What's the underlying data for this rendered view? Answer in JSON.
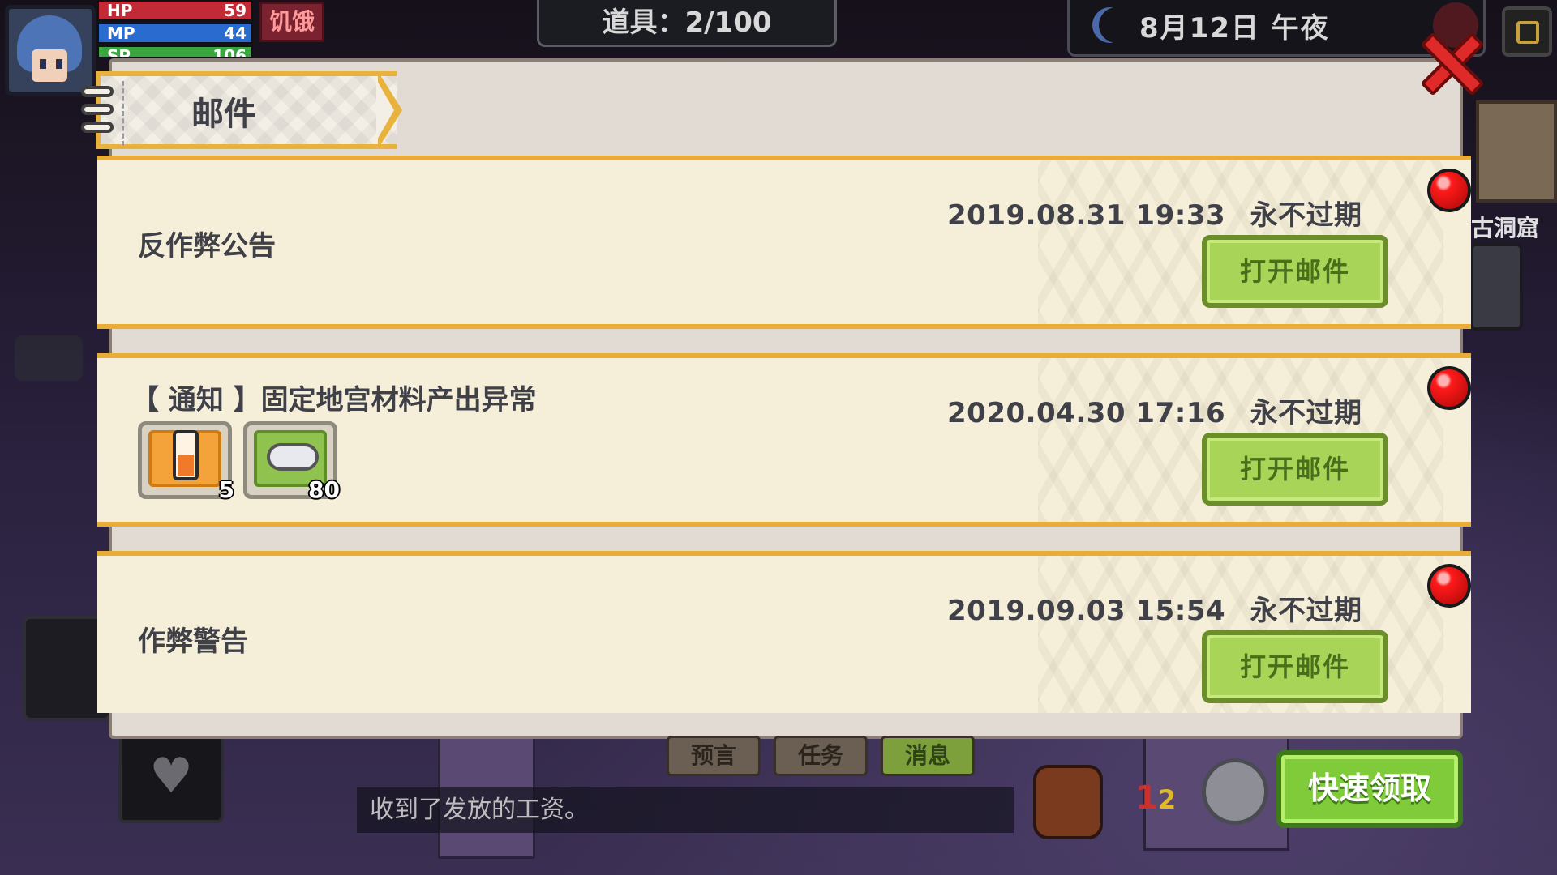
{
  "hud": {
    "hp_label": "HP",
    "hp_value": "59",
    "mp_label": "MP",
    "mp_value": "44",
    "sp_label": "SP",
    "sp_value": "106",
    "hunger_label": "饥饿",
    "items_count": "道具：2/100",
    "date": "8月12日  午夜"
  },
  "world": {
    "cave_label": "古洞窟"
  },
  "mail_panel": {
    "title": "邮件",
    "mails": [
      {
        "title": "反作弊公告",
        "date": "2019.08.31 19:33",
        "expiry": "永不过期",
        "button": "打开邮件",
        "attachments": []
      },
      {
        "title": "【 通知 】固定地宫材料产出异常",
        "date": "2020.04.30 17:16",
        "expiry": "永不过期",
        "button": "打开邮件",
        "attachments": [
          {
            "icon": "potion-bottle-icon",
            "count": "5"
          },
          {
            "icon": "cloud-material-icon",
            "count": "80"
          }
        ]
      },
      {
        "title": "作弊警告",
        "date": "2019.09.03 15:54",
        "expiry": "永不过期",
        "button": "打开邮件",
        "attachments": []
      }
    ]
  },
  "bottom": {
    "tabs": [
      "预言",
      "任务",
      "消息"
    ],
    "message": "收到了发放的工资。",
    "level_main": "1",
    "level_sub": "2",
    "quick_claim": "快速领取"
  },
  "colors": {
    "accent_gold": "#e8ac37",
    "button_green": "#a8d457",
    "notify_red": "#ff1a1a"
  }
}
